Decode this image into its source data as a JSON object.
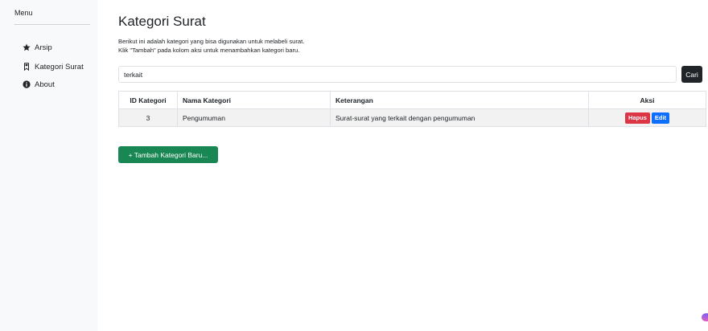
{
  "sidebar": {
    "title": "Menu",
    "items": [
      {
        "label": "Arsip",
        "icon": "star-icon"
      },
      {
        "label": "Kategori Surat",
        "icon": "bookmark-icon"
      },
      {
        "label": "About",
        "icon": "info-icon"
      }
    ]
  },
  "main": {
    "title": "Kategori Surat",
    "description_line1": "Berikut ini adalah kategori yang bisa digunakan untuk melabeli surat.",
    "description_line2": "Klik \"Tambah\" pada kolom aksi untuk menambahkan kategori baru.",
    "search": {
      "value": "terkait",
      "button_label": "Cari"
    },
    "table": {
      "headers": [
        "ID Kategori",
        "Nama Kategori",
        "Keterangan",
        "Aksi"
      ],
      "rows": [
        {
          "id": "3",
          "nama": "Pengumuman",
          "keterangan": "Surat-surat yang terkait dengan pengumuman",
          "hapus": "Hapus",
          "edit": "Edit"
        }
      ]
    },
    "add_button_label": "+ Tambah Kategori Baru..."
  },
  "colors": {
    "danger": "#dc3545",
    "primary": "#0d6efd",
    "success": "#198754",
    "dark": "#212529"
  }
}
